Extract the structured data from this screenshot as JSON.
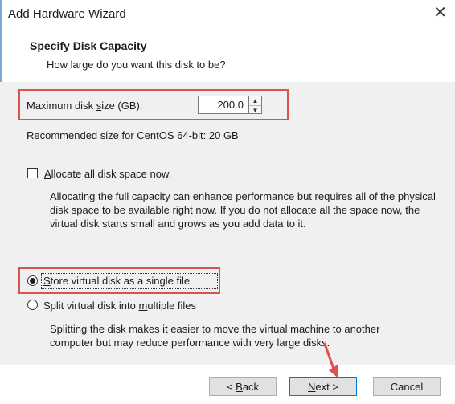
{
  "window": {
    "title": "Add Hardware Wizard",
    "close_glyph": "✕"
  },
  "header": {
    "title": "Specify Disk Capacity",
    "subtitle": "How large do you want this disk to be?"
  },
  "disk_size": {
    "label_pre": "Maximum disk ",
    "label_u": "s",
    "label_post": "ize (GB):",
    "value": "200.0",
    "recommended": "Recommended size for CentOS 64-bit: 20 GB"
  },
  "allocate": {
    "label_u": "A",
    "label_post": "llocate all disk space now.",
    "checked": false,
    "description": "Allocating the full capacity can enhance performance but requires all of the physical disk space to be available right now. If you do not allocate all the space now, the virtual disk starts small and grows as you add data to it."
  },
  "storage": {
    "single_u": "S",
    "single_post": "tore virtual disk as a single file",
    "multi_pre": "Split virtual disk into ",
    "multi_u": "m",
    "multi_post": "ultiple files",
    "selected": "single",
    "description": "Splitting the disk makes it easier to move the virtual machine to another computer but may reduce performance with very large disks."
  },
  "buttons": {
    "back_pre": "< ",
    "back_u": "B",
    "back_post": "ack",
    "next_u": "N",
    "next_post": "ext >",
    "cancel": "Cancel"
  },
  "colors": {
    "highlight": "#d9534f",
    "arrow": "#d9534f",
    "accent": "#0078d7"
  },
  "icons": {
    "close": "close-icon",
    "spin_up": "up-arrow-icon",
    "spin_down": "down-arrow-icon"
  }
}
